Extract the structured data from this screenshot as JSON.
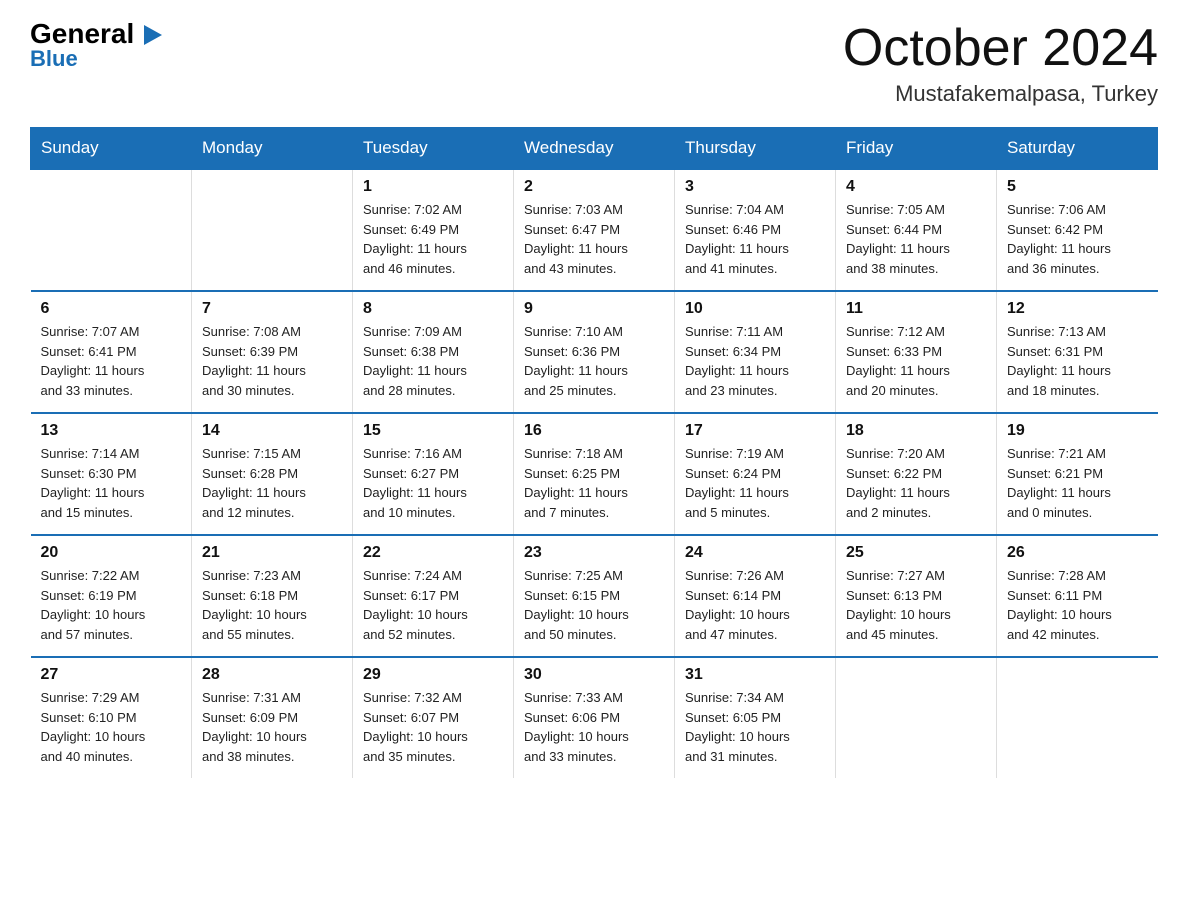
{
  "logo": {
    "general": "General",
    "blue": "Blue",
    "triangle": "▲"
  },
  "title": "October 2024",
  "location": "Mustafakemalpasa, Turkey",
  "headers": [
    "Sunday",
    "Monday",
    "Tuesday",
    "Wednesday",
    "Thursday",
    "Friday",
    "Saturday"
  ],
  "weeks": [
    [
      {
        "day": "",
        "info": ""
      },
      {
        "day": "",
        "info": ""
      },
      {
        "day": "1",
        "info": "Sunrise: 7:02 AM\nSunset: 6:49 PM\nDaylight: 11 hours\nand 46 minutes."
      },
      {
        "day": "2",
        "info": "Sunrise: 7:03 AM\nSunset: 6:47 PM\nDaylight: 11 hours\nand 43 minutes."
      },
      {
        "day": "3",
        "info": "Sunrise: 7:04 AM\nSunset: 6:46 PM\nDaylight: 11 hours\nand 41 minutes."
      },
      {
        "day": "4",
        "info": "Sunrise: 7:05 AM\nSunset: 6:44 PM\nDaylight: 11 hours\nand 38 minutes."
      },
      {
        "day": "5",
        "info": "Sunrise: 7:06 AM\nSunset: 6:42 PM\nDaylight: 11 hours\nand 36 minutes."
      }
    ],
    [
      {
        "day": "6",
        "info": "Sunrise: 7:07 AM\nSunset: 6:41 PM\nDaylight: 11 hours\nand 33 minutes."
      },
      {
        "day": "7",
        "info": "Sunrise: 7:08 AM\nSunset: 6:39 PM\nDaylight: 11 hours\nand 30 minutes."
      },
      {
        "day": "8",
        "info": "Sunrise: 7:09 AM\nSunset: 6:38 PM\nDaylight: 11 hours\nand 28 minutes."
      },
      {
        "day": "9",
        "info": "Sunrise: 7:10 AM\nSunset: 6:36 PM\nDaylight: 11 hours\nand 25 minutes."
      },
      {
        "day": "10",
        "info": "Sunrise: 7:11 AM\nSunset: 6:34 PM\nDaylight: 11 hours\nand 23 minutes."
      },
      {
        "day": "11",
        "info": "Sunrise: 7:12 AM\nSunset: 6:33 PM\nDaylight: 11 hours\nand 20 minutes."
      },
      {
        "day": "12",
        "info": "Sunrise: 7:13 AM\nSunset: 6:31 PM\nDaylight: 11 hours\nand 18 minutes."
      }
    ],
    [
      {
        "day": "13",
        "info": "Sunrise: 7:14 AM\nSunset: 6:30 PM\nDaylight: 11 hours\nand 15 minutes."
      },
      {
        "day": "14",
        "info": "Sunrise: 7:15 AM\nSunset: 6:28 PM\nDaylight: 11 hours\nand 12 minutes."
      },
      {
        "day": "15",
        "info": "Sunrise: 7:16 AM\nSunset: 6:27 PM\nDaylight: 11 hours\nand 10 minutes."
      },
      {
        "day": "16",
        "info": "Sunrise: 7:18 AM\nSunset: 6:25 PM\nDaylight: 11 hours\nand 7 minutes."
      },
      {
        "day": "17",
        "info": "Sunrise: 7:19 AM\nSunset: 6:24 PM\nDaylight: 11 hours\nand 5 minutes."
      },
      {
        "day": "18",
        "info": "Sunrise: 7:20 AM\nSunset: 6:22 PM\nDaylight: 11 hours\nand 2 minutes."
      },
      {
        "day": "19",
        "info": "Sunrise: 7:21 AM\nSunset: 6:21 PM\nDaylight: 11 hours\nand 0 minutes."
      }
    ],
    [
      {
        "day": "20",
        "info": "Sunrise: 7:22 AM\nSunset: 6:19 PM\nDaylight: 10 hours\nand 57 minutes."
      },
      {
        "day": "21",
        "info": "Sunrise: 7:23 AM\nSunset: 6:18 PM\nDaylight: 10 hours\nand 55 minutes."
      },
      {
        "day": "22",
        "info": "Sunrise: 7:24 AM\nSunset: 6:17 PM\nDaylight: 10 hours\nand 52 minutes."
      },
      {
        "day": "23",
        "info": "Sunrise: 7:25 AM\nSunset: 6:15 PM\nDaylight: 10 hours\nand 50 minutes."
      },
      {
        "day": "24",
        "info": "Sunrise: 7:26 AM\nSunset: 6:14 PM\nDaylight: 10 hours\nand 47 minutes."
      },
      {
        "day": "25",
        "info": "Sunrise: 7:27 AM\nSunset: 6:13 PM\nDaylight: 10 hours\nand 45 minutes."
      },
      {
        "day": "26",
        "info": "Sunrise: 7:28 AM\nSunset: 6:11 PM\nDaylight: 10 hours\nand 42 minutes."
      }
    ],
    [
      {
        "day": "27",
        "info": "Sunrise: 7:29 AM\nSunset: 6:10 PM\nDaylight: 10 hours\nand 40 minutes."
      },
      {
        "day": "28",
        "info": "Sunrise: 7:31 AM\nSunset: 6:09 PM\nDaylight: 10 hours\nand 38 minutes."
      },
      {
        "day": "29",
        "info": "Sunrise: 7:32 AM\nSunset: 6:07 PM\nDaylight: 10 hours\nand 35 minutes."
      },
      {
        "day": "30",
        "info": "Sunrise: 7:33 AM\nSunset: 6:06 PM\nDaylight: 10 hours\nand 33 minutes."
      },
      {
        "day": "31",
        "info": "Sunrise: 7:34 AM\nSunset: 6:05 PM\nDaylight: 10 hours\nand 31 minutes."
      },
      {
        "day": "",
        "info": ""
      },
      {
        "day": "",
        "info": ""
      }
    ]
  ]
}
